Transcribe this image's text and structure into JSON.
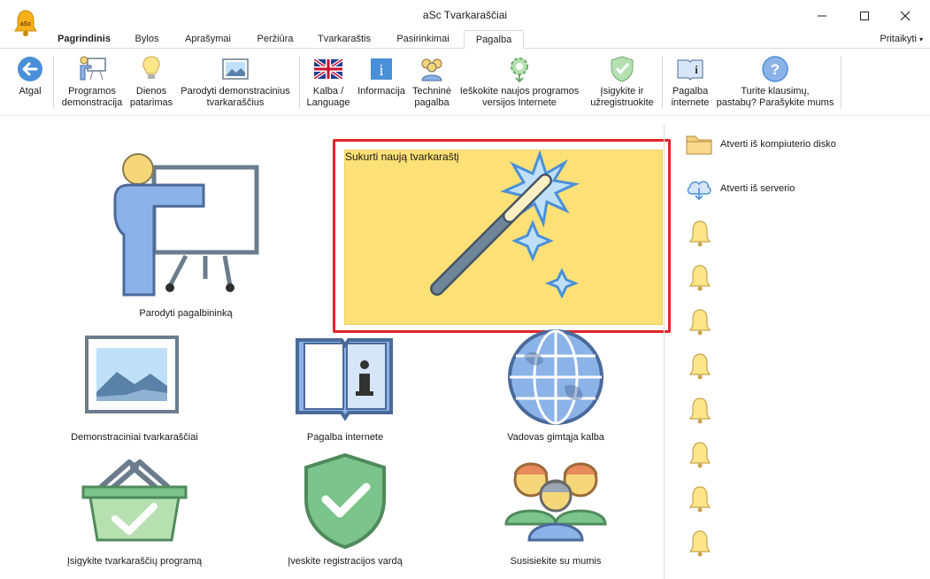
{
  "window": {
    "title": "aSc Tvarkaraščiai",
    "logo_text": "aSc"
  },
  "menu": {
    "tabs": [
      "Pagrindinis",
      "Bylos",
      "Aprašymai",
      "Peržiūra",
      "Tvarkaraštis",
      "Pasirinkimai",
      "Pagalba"
    ],
    "active_tab": "Pagalba",
    "customize": "Pritaikyti"
  },
  "ribbon": {
    "back": "Atgal",
    "demo": "Programos\ndemonstracija",
    "tips": "Dienos\npatarimas",
    "show_demo": "Parodyti demonstracinius\ntvarkaraščius",
    "language": "Kalba /\nLanguage",
    "info": "Informacija",
    "tech_support": "Techninė\npagalba",
    "new_version": "Ieškokite naujos programos\nversijos Internete",
    "register": "Įsigykite ir\nužregistruokite",
    "help_online": "Pagalba\ninternete",
    "questions": "Turite klausimų,\npastabų? Parašykite mums"
  },
  "tiles": {
    "assistant": "Parodyti pagalbininką",
    "new_timetable": "Sukurti naują tvarkaraštį",
    "demo_timetables": "Demonstraciniai tvarkaraščiai",
    "help_online": "Pagalba internete",
    "native_guide": "Vadovas gimtąja kalba",
    "buy": "Įsigykite tvarkaraščių programą",
    "enter_reg": "Įveskite registracijos vardą",
    "contact": "Susisiekite su mumis"
  },
  "side": {
    "open_disk": "Atverti iš kompiuterio disko",
    "open_server": "Atverti iš serverio"
  },
  "colors": {
    "accent_blue": "#4a90d9",
    "highlight_red": "#e0262b",
    "tile_yellow": "#fde076",
    "check_green": "#7bc48b"
  }
}
